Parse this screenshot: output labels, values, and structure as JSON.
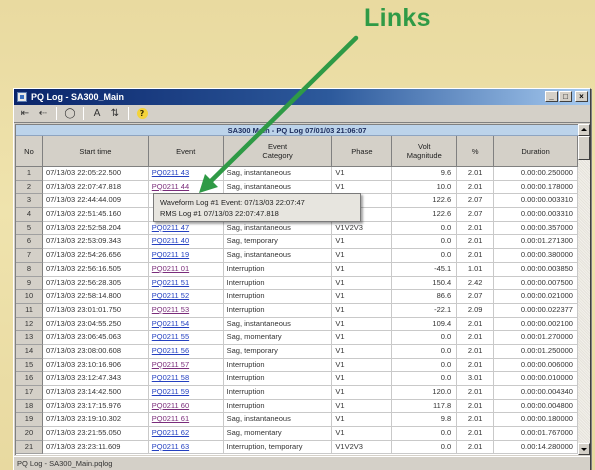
{
  "annotation": {
    "label": "Links"
  },
  "colors": {
    "annotation_green": "#2f9a46",
    "title_bar_start": "#0a246a",
    "title_bar_end": "#a6caf0",
    "link": "#2440c0",
    "link_visited": "#7a2c7a"
  },
  "window": {
    "title": "PQ Log - SA300_Main",
    "controls": [
      "_",
      "□",
      "×"
    ]
  },
  "toolbar": {
    "items": [
      {
        "name": "first-record",
        "icon": "nav-first-icon",
        "glyph": "⇤"
      },
      {
        "name": "back",
        "icon": "nav-back-icon",
        "glyph": "⇠"
      },
      {
        "name": "stop",
        "icon": "stop-icon",
        "glyph": "◯"
      },
      {
        "name": "font",
        "icon": "font-icon",
        "glyph": "A"
      },
      {
        "name": "sort",
        "icon": "sort-icon",
        "glyph": "⇅"
      },
      {
        "name": "help",
        "icon": "help-icon",
        "glyph": "?"
      }
    ]
  },
  "table": {
    "title": "SA300 Main - PQ Log 07/01/03 21:06:07",
    "columns": [
      "No",
      "Start time",
      "Event",
      "Event\nCategory",
      "Phase",
      "Volt\nMagnitude",
      "%",
      "Duration"
    ],
    "rows": [
      {
        "no": "1",
        "start": "07/13/03 22:05:22.500",
        "event": "PQ0211 43",
        "visited": false,
        "category": "Sag, instantaneous",
        "phase": "V1",
        "magnitude": "9.6",
        "pct": "2.01",
        "duration": "0.00:00.250000"
      },
      {
        "no": "2",
        "start": "07/13/03 22:07:47.818",
        "event": "PQ0211 44",
        "visited": true,
        "category": "Sag, instantaneous",
        "phase": "V1",
        "magnitude": "10.0",
        "pct": "2.01",
        "duration": "0.00:00.178000"
      },
      {
        "no": "3",
        "start": "07/13/03 22:44:44.009",
        "event": "",
        "visited": false,
        "category": "",
        "phase": "",
        "magnitude": "122.6",
        "pct": "2.07",
        "duration": "0.00:00.003310"
      },
      {
        "no": "4",
        "start": "07/13/03 22:51:45.160",
        "event": "",
        "visited": false,
        "category": "",
        "phase": "",
        "magnitude": "122.6",
        "pct": "2.07",
        "duration": "0.00:00.003310"
      },
      {
        "no": "5",
        "start": "07/13/03 22:52:58.204",
        "event": "PQ0211 47",
        "visited": false,
        "category": "Sag, instantaneous",
        "phase": "V1V2V3",
        "magnitude": "0.0",
        "pct": "2.01",
        "duration": "0.00:00.357000"
      },
      {
        "no": "6",
        "start": "07/13/03 22:53:09.343",
        "event": "PQ0211 40",
        "visited": false,
        "category": "Sag, temporary",
        "phase": "V1",
        "magnitude": "0.0",
        "pct": "2.01",
        "duration": "0.00:01.271300"
      },
      {
        "no": "7",
        "start": "07/13/03 22:54:26.656",
        "event": "PQ0211 19",
        "visited": false,
        "category": "Sag, instantaneous",
        "phase": "V1",
        "magnitude": "0.0",
        "pct": "2.01",
        "duration": "0.00:00.380000"
      },
      {
        "no": "8",
        "start": "07/13/03 22:56:16.505",
        "event": "PQ0211 01",
        "visited": true,
        "category": "Interruption",
        "phase": "V1",
        "magnitude": "-45.1",
        "pct": "1.01",
        "duration": "0.00:00.003850"
      },
      {
        "no": "9",
        "start": "07/13/03 22:56:28.305",
        "event": "PQ0211 51",
        "visited": false,
        "category": "Interruption",
        "phase": "V1",
        "magnitude": "150.4",
        "pct": "2.42",
        "duration": "0.00:00.007500"
      },
      {
        "no": "10",
        "start": "07/13/03 22:58:14.800",
        "event": "PQ0211 52",
        "visited": false,
        "category": "Interruption",
        "phase": "V1",
        "magnitude": "86.6",
        "pct": "2.07",
        "duration": "0.00:00.021000"
      },
      {
        "no": "11",
        "start": "07/13/03 23:01:01.750",
        "event": "PQ0211 53",
        "visited": true,
        "category": "Interruption",
        "phase": "V1",
        "magnitude": "-22.1",
        "pct": "2.09",
        "duration": "0.00:00.022377"
      },
      {
        "no": "12",
        "start": "07/13/03 23:04:55.250",
        "event": "PQ0211 54",
        "visited": false,
        "category": "Sag, instantaneous",
        "phase": "V1",
        "magnitude": "109.4",
        "pct": "2.01",
        "duration": "0.00:00.002100"
      },
      {
        "no": "13",
        "start": "07/13/03 23:06:45.063",
        "event": "PQ0211 55",
        "visited": false,
        "category": "Sag, momentary",
        "phase": "V1",
        "magnitude": "0.0",
        "pct": "2.01",
        "duration": "0.00:01.270000"
      },
      {
        "no": "14",
        "start": "07/13/03 23:08:00.608",
        "event": "PQ0211 56",
        "visited": false,
        "category": "Sag, temporary",
        "phase": "V1",
        "magnitude": "0.0",
        "pct": "2.01",
        "duration": "0.00:01.250000"
      },
      {
        "no": "15",
        "start": "07/13/03 23:10:16.906",
        "event": "PQ0211 57",
        "visited": true,
        "category": "Interruption",
        "phase": "V1",
        "magnitude": "0.0",
        "pct": "2.01",
        "duration": "0.00:00.006000"
      },
      {
        "no": "16",
        "start": "07/13/03 23:12:47.343",
        "event": "PQ0211 58",
        "visited": false,
        "category": "Interruption",
        "phase": "V1",
        "magnitude": "0.0",
        "pct": "3.01",
        "duration": "0.00:00.010000"
      },
      {
        "no": "17",
        "start": "07/13/03 23:14:42.500",
        "event": "PQ0211 59",
        "visited": false,
        "category": "Interruption",
        "phase": "V1",
        "magnitude": "120.0",
        "pct": "2.01",
        "duration": "0.00:00.004340"
      },
      {
        "no": "18",
        "start": "07/13/03 23:17:15.976",
        "event": "PQ0211 60",
        "visited": true,
        "category": "Interruption",
        "phase": "V1",
        "magnitude": "117.8",
        "pct": "2.01",
        "duration": "0.00:00.004800"
      },
      {
        "no": "19",
        "start": "07/13/03 23:19:10.302",
        "event": "PQ0211 61",
        "visited": true,
        "category": "Sag, instantaneous",
        "phase": "V1",
        "magnitude": "9.8",
        "pct": "2.01",
        "duration": "0.00:00.180000"
      },
      {
        "no": "20",
        "start": "07/13/03 23:21:55.050",
        "event": "PQ0211 62",
        "visited": false,
        "category": "Sag, momentary",
        "phase": "V1",
        "magnitude": "0.0",
        "pct": "2.01",
        "duration": "0.00:01.767000"
      },
      {
        "no": "21",
        "start": "07/13/03 23:23:11.609",
        "event": "PQ0211 63",
        "visited": false,
        "category": "Interruption, temporary",
        "phase": "V1V2V3",
        "magnitude": "0.0",
        "pct": "2.01",
        "duration": "0.00:14.280000"
      }
    ]
  },
  "tooltip": {
    "lines": [
      "Waveform Log #1 Event: 07/13/03 22:07:47",
      "RMS Log #1 07/13/03 22:07:47.818"
    ]
  },
  "status_bar": {
    "text": "PQ Log - SA300_Main.pqlog"
  }
}
